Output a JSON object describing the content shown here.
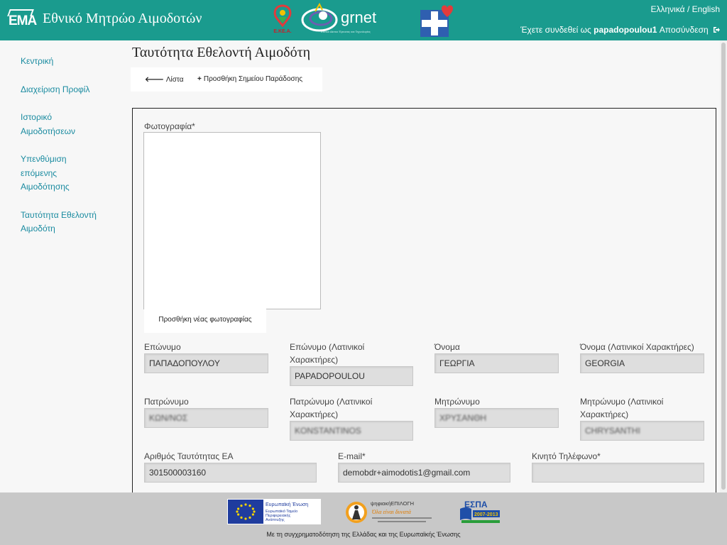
{
  "header": {
    "site_title": "Εθνικό Μητρώο Αιμοδοτών",
    "logo_text": "EMA",
    "ekea_text": "Ε.ΚΕ.Α.",
    "grnet_text": "grnet",
    "grnet_subtitle": "Εθνικό Δίκτυο Έρευνας και Τεχνολογίας",
    "lang_greek": "Ελληνικά",
    "lang_sep": " / ",
    "lang_english": "English",
    "login_prefix": "Έχετε συνδεθεί ως ",
    "username": "papadopoulou1",
    "logout": " Αποσύνδεση"
  },
  "sidebar": {
    "items": [
      {
        "label": "Κεντρική"
      },
      {
        "label": "Διαχείριση Προφίλ"
      },
      {
        "label": "Ιστορικό Αιμοδοτήσεων"
      },
      {
        "label": "Υπενθύμιση επόμενης Αιμοδότησης"
      },
      {
        "label": "Ταυτότητα Εθελοντή Αιμοδότη"
      }
    ]
  },
  "main": {
    "title": "Ταυτότητα Εθελοντή Αιμοδότη",
    "toolbar": {
      "list_label": "Λίστα",
      "add_point_label": "Προσθήκη Σημείου Παράδοσης"
    },
    "form": {
      "photo_label": "Φωτογραφία*",
      "add_photo_label": "Προσθήκη νέας φωτογραφίας",
      "surname_label": "Επώνυμο",
      "surname_value": "ΠΑΠΑΔΟΠΟΥΛΟΥ",
      "surname_latin_label": "Επώνυμο (Λατινικοί Χαρακτήρες)",
      "surname_latin_value": "PAPADOPOULOU",
      "name_label": "Όνομα",
      "name_value": "ΓΕΩΡΓΙΑ",
      "name_latin_label": "Όνομα (Λατινικοί Χαρακτήρες)",
      "name_latin_value": "GEORGIA",
      "father_label": "Πατρώνυμο",
      "father_value": "ΚΩΝ/ΝΟΣ",
      "father_latin_label": "Πατρώνυμο (Λατινικοί Χαρακτήρες)",
      "father_latin_value": "KONSTANTINOS",
      "mother_label": "Μητρώνυμο",
      "mother_value": "ΧΡΥΣΑΝΘΗ",
      "mother_latin_label": "Μητρώνυμο (Λατινικοί Χαρακτήρες)",
      "mother_latin_value": "CHRYSANTHI",
      "id_label": "Αριθμός Ταυτότητας ΕΑ",
      "id_value": "301500003160",
      "email_label": "E-mail*",
      "email_value": "demobdr+aimodotis1@gmail.com",
      "mobile_label": "Κινητό Τηλέφωνο*",
      "mobile_value": ""
    }
  },
  "footer": {
    "eu_title": "Ευρωπαϊκή Ένωση",
    "eu_sub1": "Ευρωπαϊκό Ταμείο",
    "eu_sub2": "Περιφερειακής",
    "eu_sub3": "Ανάπτυξης",
    "digital_title": "ψηφιακήΕΠΙΛΟΓΗ",
    "digital_sub": "Όλα είναι δυνατά",
    "espa_label": "ΕΣΠΑ",
    "espa_years": "2007-2013",
    "cofinance_text": "Με τη συγχρηματοδότηση της Ελλάδας και της Ευρωπαϊκής Ένωσης"
  },
  "colors": {
    "header_bg": "#1a9b8e",
    "link": "#1a8ba0",
    "footer_bg": "#c8c8c8"
  }
}
